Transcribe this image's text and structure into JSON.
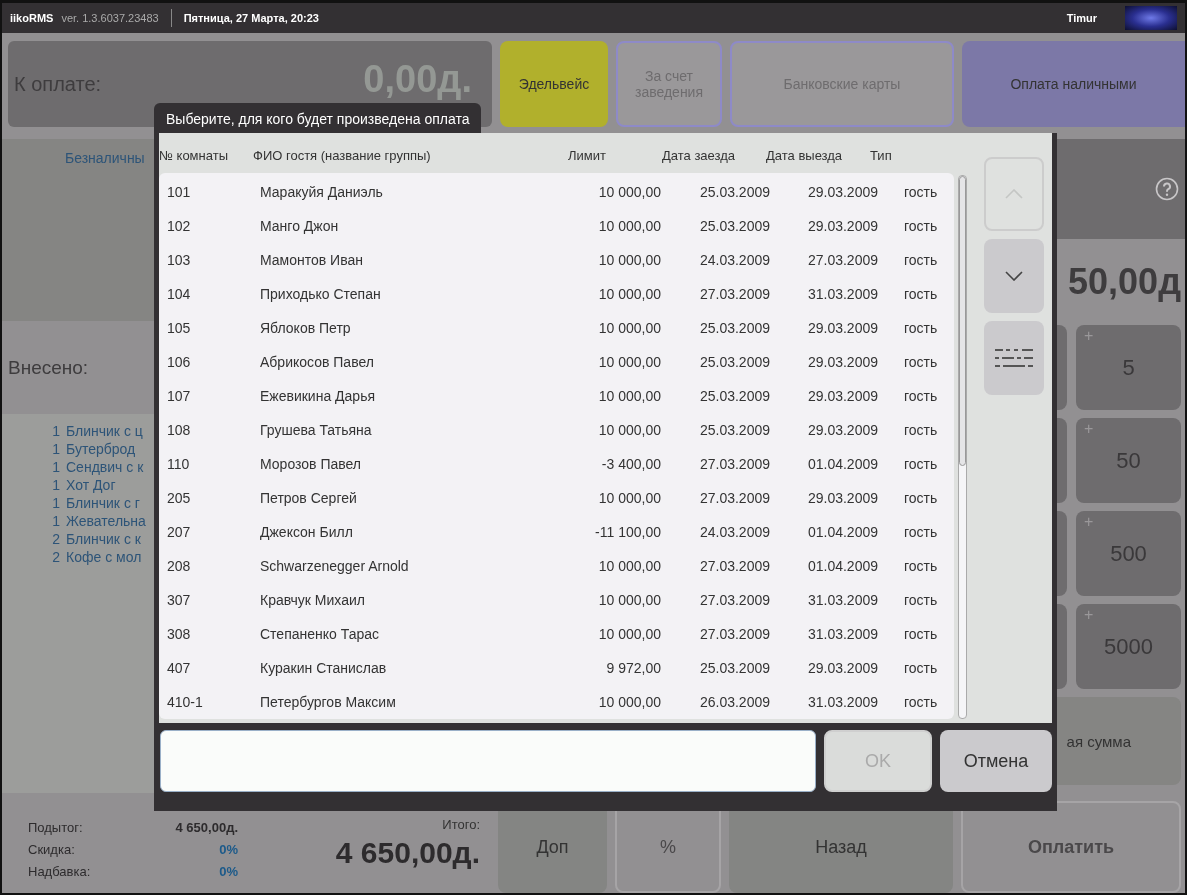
{
  "app_bar": {
    "app_name": "iikoRMS",
    "version": "ver. 1.3.6037.23483",
    "datetime": "Пятница, 27 Марта, 20:23",
    "user": "Timur"
  },
  "to_pay": {
    "label": "К оплате:",
    "amount": "0,00д."
  },
  "payment_types": [
    {
      "label": "Эдельвейс",
      "color": "#b1b02c",
      "disabled": false
    },
    {
      "label": "За счет заведения",
      "color": "#9a989a",
      "disabled": true
    },
    {
      "label": "Банковские карты",
      "color": "#9a989a",
      "disabled": true
    },
    {
      "label": "Оплата наличными",
      "color": "#7c78a7",
      "disabled": false
    }
  ],
  "payment_detail": {
    "label": "Безналичны"
  },
  "paid": {
    "label": "Внесено:"
  },
  "order_items": [
    {
      "qty": "1",
      "name": "Блинчик с ц"
    },
    {
      "qty": "1",
      "name": "Бутерброд"
    },
    {
      "qty": "1",
      "name": "Сендвич с к"
    },
    {
      "qty": "1",
      "name": "Хот Дог"
    },
    {
      "qty": "1",
      "name": "Блинчик с г"
    },
    {
      "qty": "1",
      "name": "Жевательна"
    },
    {
      "qty": "2",
      "name": "Блинчик с к"
    },
    {
      "qty": "2",
      "name": "Кофе с мол"
    }
  ],
  "balance": {
    "amount": "50,00д"
  },
  "keypad": [
    {
      "sign": "+",
      "label": "5"
    },
    {
      "sign": "+",
      "label": "50"
    },
    {
      "sign": "+",
      "label": "500"
    },
    {
      "sign": "+",
      "label": "5000"
    }
  ],
  "sum_button": {
    "label": "ая сумма"
  },
  "totals": {
    "subtotal_label": "Подытог:",
    "subtotal": "4 650,00д.",
    "discount_label": "Скидка:",
    "discount": "0%",
    "surcharge_label": "Надбавка:",
    "surcharge": "0%",
    "total_label": "Итого:",
    "total": "4 650,00д."
  },
  "bottom_buttons": [
    {
      "label": "Доп",
      "disabled": false
    },
    {
      "label": "%",
      "disabled": true
    },
    {
      "label": "Назад",
      "disabled": false
    },
    {
      "label": "Оплатить",
      "disabled": true
    }
  ],
  "dialog": {
    "title": "Выберите, для кого будет произведена оплата",
    "columns": [
      "№ комнаты",
      "ФИО гостя (название группы)",
      "Лимит",
      "Дата заезда",
      "Дата выезда",
      "Тип"
    ],
    "rows": [
      [
        "101",
        "Маракуйя Даниэль",
        "10 000,00",
        "25.03.2009",
        "29.03.2009",
        "гость"
      ],
      [
        "102",
        "Манго Джон",
        "10 000,00",
        "25.03.2009",
        "29.03.2009",
        "гость"
      ],
      [
        "103",
        "Мамонтов Иван",
        "10 000,00",
        "24.03.2009",
        "27.03.2009",
        "гость"
      ],
      [
        "104",
        "Приходько Степан",
        "10 000,00",
        "27.03.2009",
        "31.03.2009",
        "гость"
      ],
      [
        "105",
        "Яблоков Петр",
        "10 000,00",
        "25.03.2009",
        "29.03.2009",
        "гость"
      ],
      [
        "106",
        "Абрикосов Павел",
        "10 000,00",
        "25.03.2009",
        "29.03.2009",
        "гость"
      ],
      [
        "107",
        "Ежевикина Дарья",
        "10 000,00",
        "25.03.2009",
        "29.03.2009",
        "гость"
      ],
      [
        "108",
        "Грушева Татьяна",
        "10 000,00",
        "25.03.2009",
        "29.03.2009",
        "гость"
      ],
      [
        "110",
        "Морозов Павел",
        "-3 400,00",
        "27.03.2009",
        "01.04.2009",
        "гость"
      ],
      [
        "205",
        "Петров Сергей",
        "10 000,00",
        "27.03.2009",
        "29.03.2009",
        "гость"
      ],
      [
        "207",
        "Джексон Билл",
        "-11 100,00",
        "24.03.2009",
        "01.04.2009",
        "гость"
      ],
      [
        "208",
        "Schwarzenegger Arnold",
        "10 000,00",
        "27.03.2009",
        "01.04.2009",
        "гость"
      ],
      [
        "307",
        "Кравчук Михаил",
        "10 000,00",
        "27.03.2009",
        "31.03.2009",
        "гость"
      ],
      [
        "308",
        "Степаненко Тарас",
        "10 000,00",
        "27.03.2009",
        "31.03.2009",
        "гость"
      ],
      [
        "407",
        "Куракин Станислав",
        "9 972,00",
        "25.03.2009",
        "29.03.2009",
        "гость"
      ],
      [
        "410-1",
        "Петербургов Максим",
        "10 000,00",
        "26.03.2009",
        "31.03.2009",
        "гость"
      ]
    ],
    "side_buttons": [
      {
        "kind": "up",
        "disabled": true
      },
      {
        "kind": "down",
        "disabled": false
      },
      {
        "kind": "keyboard",
        "disabled": false
      }
    ],
    "ok": {
      "label": "OK",
      "disabled": true
    },
    "cancel": {
      "label": "Отмена"
    }
  }
}
